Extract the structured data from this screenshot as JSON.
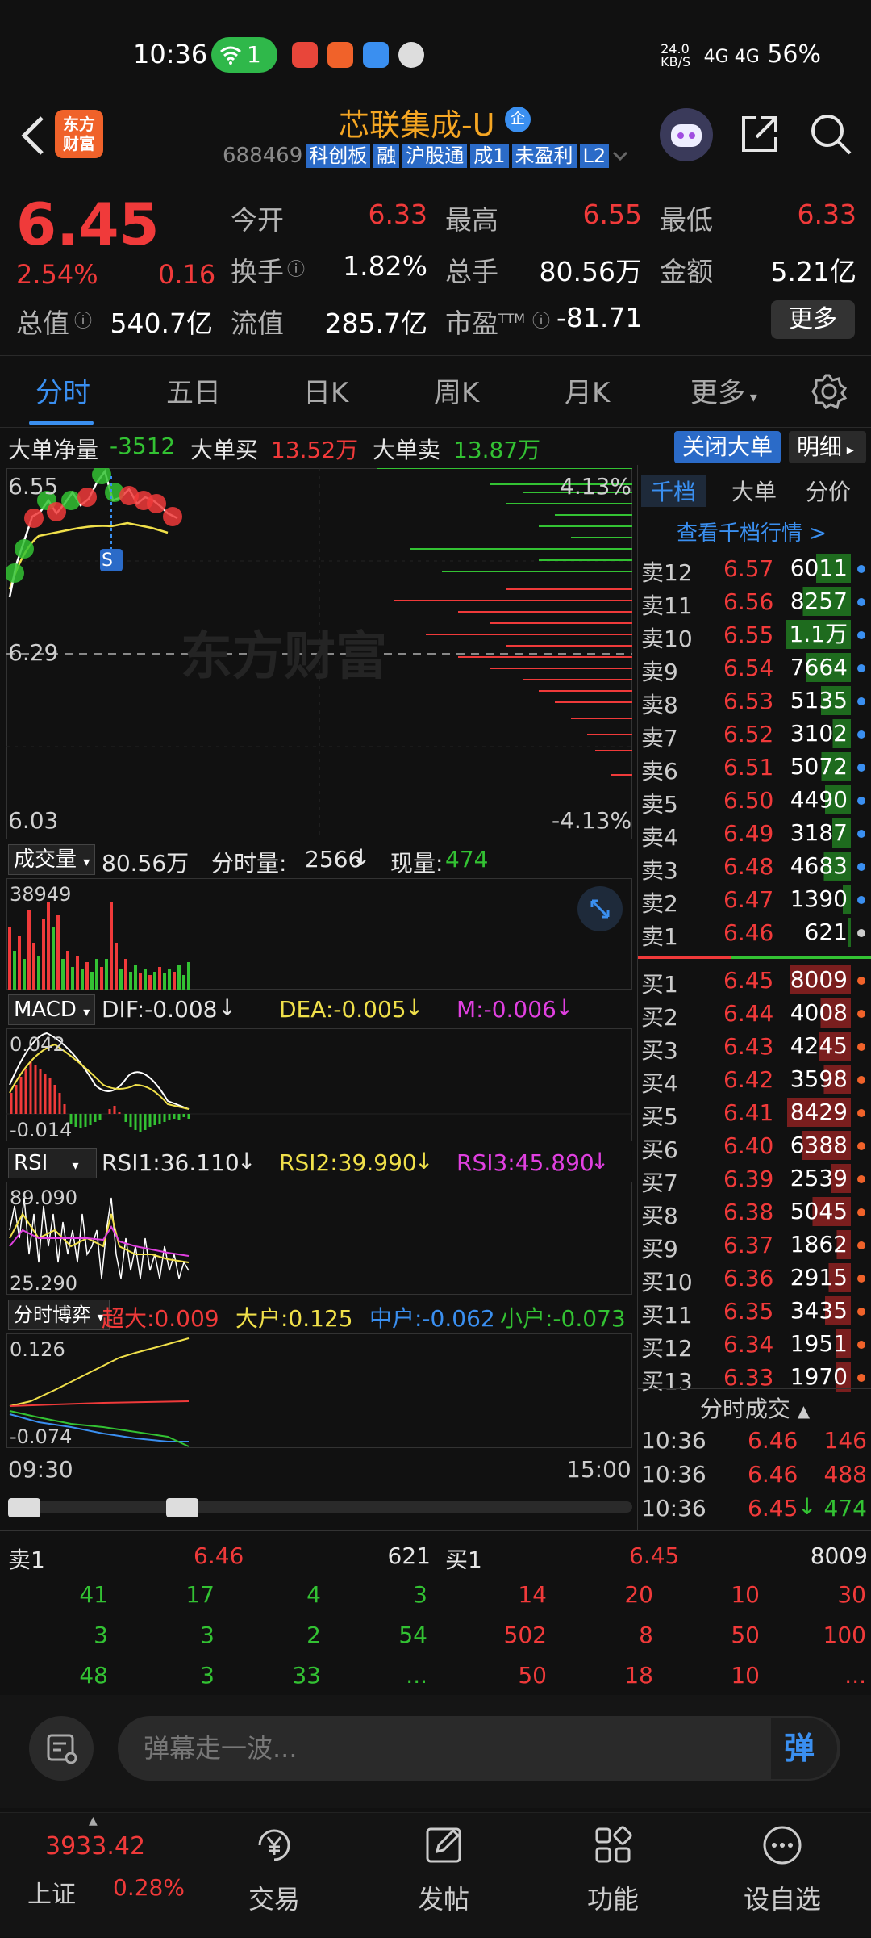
{
  "status_bar": {
    "time": "10:36",
    "wifi_count": "1",
    "net_speed": "24.0\nKB/S",
    "signal_text": "4G 4G",
    "battery": "56%"
  },
  "header": {
    "logo_text": "东方\n财富",
    "title": "芯联集成-U",
    "qi_badge": "企",
    "code": "688469",
    "tags": [
      "科创板",
      "融",
      "沪股通",
      "成1",
      "未盈利",
      "L2"
    ]
  },
  "quote": {
    "price": "6.45",
    "pct": "2.54%",
    "chg": "0.16",
    "open_label": "今开",
    "open_val": "6.33",
    "high_label": "最高",
    "high_val": "6.55",
    "low_label": "最低",
    "low_val": "6.33",
    "turnover_label": "换手",
    "turnover_val": "1.82%",
    "volume_label": "总手",
    "volume_val": "80.56万",
    "amount_label": "金额",
    "amount_val": "5.21亿",
    "mktcap_label": "总值",
    "mktcap_val": "540.7亿",
    "float_label": "流值",
    "float_val": "285.7亿",
    "pe_label": "市盈",
    "pe_sup": "TTM",
    "pe_val": "-81.71",
    "more_label": "更多"
  },
  "tabs": [
    "分时",
    "五日",
    "日K",
    "周K",
    "月K",
    "更多"
  ],
  "big_orders": {
    "net_label": "大单净量",
    "net_val": "-3512",
    "buy_label": "大单买",
    "buy_val": "13.52万",
    "sell_label": "大单卖",
    "sell_val": "13.87万",
    "close_btn": "关闭大单",
    "detail_btn": "明细"
  },
  "price_chart": {
    "high": "6.55",
    "pre_close": "6.29",
    "low": "6.03",
    "pct_up": "4.13%",
    "pct_down": "-4.13%",
    "watermark": "东方财富",
    "marker": "S"
  },
  "volume_panel": {
    "btn": "成交量",
    "total": "80.56万",
    "tick_label": "分时量:",
    "tick_val": "2566",
    "cur_label": "现量:",
    "cur_val": "474",
    "max": "38949"
  },
  "macd_panel": {
    "btn": "MACD",
    "dif": "DIF:-0.008",
    "dea": "DEA:-0.005",
    "m": "M:-0.006",
    "top": "0.042",
    "bottom": "-0.014"
  },
  "rsi_panel": {
    "btn": "RSI",
    "rsi1": "RSI1:36.110",
    "rsi2": "RSI2:39.990",
    "rsi3": "RSI3:45.890",
    "top": "89.090",
    "bottom": "25.290"
  },
  "flow_panel": {
    "btn": "分时博弈",
    "super": "超大:0.009",
    "large": "大户:0.125",
    "mid": "中户:-0.062",
    "small": "小户:-0.073",
    "top": "0.126",
    "bottom": "-0.074"
  },
  "time_axis": {
    "start": "09:30",
    "end": "15:00"
  },
  "orderbook": {
    "tabs": [
      "千档",
      "大单",
      "分价"
    ],
    "link": "查看千档行情 >",
    "asks": [
      {
        "label": "卖12",
        "price": "6.57",
        "vol": "6011"
      },
      {
        "label": "卖11",
        "price": "6.56",
        "vol": "8257"
      },
      {
        "label": "卖10",
        "price": "6.55",
        "vol": "1.1万"
      },
      {
        "label": "卖9",
        "price": "6.54",
        "vol": "7664"
      },
      {
        "label": "卖8",
        "price": "6.53",
        "vol": "5135"
      },
      {
        "label": "卖7",
        "price": "6.52",
        "vol": "3102"
      },
      {
        "label": "卖6",
        "price": "6.51",
        "vol": "5072"
      },
      {
        "label": "卖5",
        "price": "6.50",
        "vol": "4490"
      },
      {
        "label": "卖4",
        "price": "6.49",
        "vol": "3187"
      },
      {
        "label": "卖3",
        "price": "6.48",
        "vol": "4683"
      },
      {
        "label": "卖2",
        "price": "6.47",
        "vol": "1390"
      },
      {
        "label": "卖1",
        "price": "6.46",
        "vol": "621"
      }
    ],
    "bids": [
      {
        "label": "买1",
        "price": "6.45",
        "vol": "8009"
      },
      {
        "label": "买2",
        "price": "6.44",
        "vol": "4008"
      },
      {
        "label": "买3",
        "price": "6.43",
        "vol": "4245"
      },
      {
        "label": "买4",
        "price": "6.42",
        "vol": "3598"
      },
      {
        "label": "买5",
        "price": "6.41",
        "vol": "8429"
      },
      {
        "label": "买6",
        "price": "6.40",
        "vol": "6388"
      },
      {
        "label": "买7",
        "price": "6.39",
        "vol": "2539"
      },
      {
        "label": "买8",
        "price": "6.38",
        "vol": "5045"
      },
      {
        "label": "买9",
        "price": "6.37",
        "vol": "1862"
      },
      {
        "label": "买10",
        "price": "6.36",
        "vol": "2915"
      },
      {
        "label": "买11",
        "price": "6.35",
        "vol": "3435"
      },
      {
        "label": "买12",
        "price": "6.34",
        "vol": "1951"
      },
      {
        "label": "买13",
        "price": "6.33",
        "vol": "1970"
      }
    ],
    "ticks_header": "分时成交",
    "ticks": [
      {
        "time": "10:36",
        "price": "6.46",
        "vol": "146"
      },
      {
        "time": "10:36",
        "price": "6.46",
        "vol": "488"
      },
      {
        "time": "10:36",
        "price": "6.45",
        "vol": "474"
      }
    ]
  },
  "queue": {
    "sell_label": "卖1",
    "sell_price": "6.46",
    "sell_vol": "621",
    "buy_label": "买1",
    "buy_price": "6.45",
    "buy_vol": "8009",
    "sell_rows": [
      [
        "41",
        "17",
        "4",
        "3"
      ],
      [
        "3",
        "3",
        "2",
        "54"
      ],
      [
        "48",
        "3",
        "33",
        "..."
      ]
    ],
    "buy_rows": [
      [
        "14",
        "20",
        "10",
        "30"
      ],
      [
        "502",
        "8",
        "50",
        "100"
      ],
      [
        "50",
        "18",
        "10",
        "..."
      ]
    ]
  },
  "comment": {
    "placeholder": "弹幕走一波...",
    "danmu": "弹"
  },
  "bottom_nav": {
    "index_val": "3933.42",
    "index_name": "上证",
    "index_pct": "0.28%",
    "items": [
      "交易",
      "发帖",
      "功能",
      "设自选"
    ]
  }
}
